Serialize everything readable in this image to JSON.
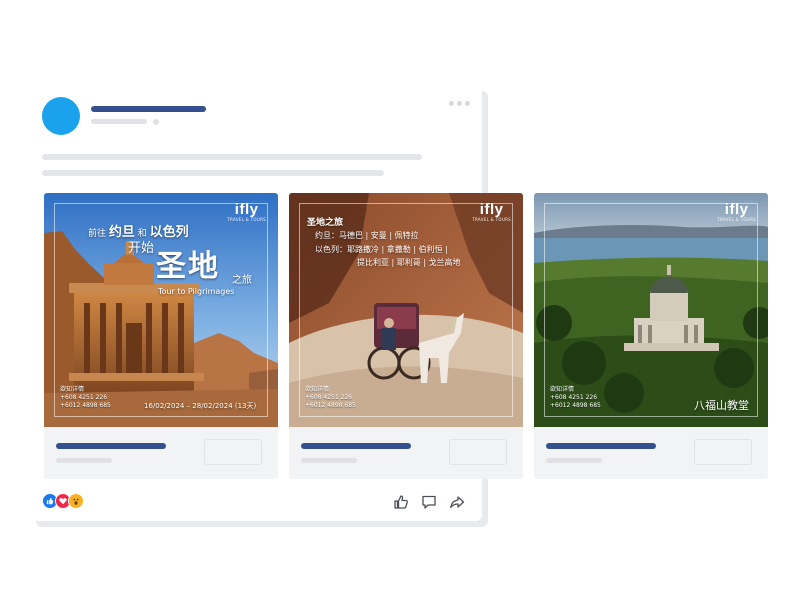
{
  "cards": [
    {
      "brand": "ifly",
      "brand_tag": "TRAVEL & TOURS",
      "line1_pre": "前往",
      "line1_country1": "约旦",
      "line1_and": "和",
      "line1_country2": "以色列",
      "line2": "开始",
      "headline": "圣地",
      "suffix": "之旅",
      "subtitle": "Tour to Pilgrimages",
      "contact_label": "欲知详情",
      "phone1": "+608 4251 226",
      "phone2": "+6012 4898 685",
      "dates": "16/02/2024 – 28/02/2024 (13天)"
    },
    {
      "brand": "ifly",
      "brand_tag": "TRAVEL & TOURS",
      "title": "圣地之旅",
      "line1": "约旦：马德巴 | 安曼 | 佩特拉",
      "line2": "以色列：耶路撒冷 | 拿撒勒 | 伯利恒 |",
      "line3": "提比利亚 | 耶利哥 | 戈兰高地",
      "contact_label": "欲知详情",
      "phone1": "+608 4251 226",
      "phone2": "+6012 4898 685"
    },
    {
      "brand": "ifly",
      "brand_tag": "TRAVEL & TOURS",
      "contact_label": "欲知详情",
      "phone1": "+608 4251 226",
      "phone2": "+6012 4898 685",
      "place": "八福山教堂"
    }
  ],
  "icons": {
    "reaction_like": "like-reaction-icon",
    "reaction_love": "love-reaction-icon",
    "reaction_wow": "wow-reaction-icon",
    "like": "thumbs-up-icon",
    "comment": "comment-icon",
    "share": "share-icon"
  },
  "colors": {
    "avatar": "#1aa3ec",
    "placeholder_title": "#33508f",
    "placeholder_gray": "#e3e5e8",
    "card_bg": "#f2f3f5"
  }
}
